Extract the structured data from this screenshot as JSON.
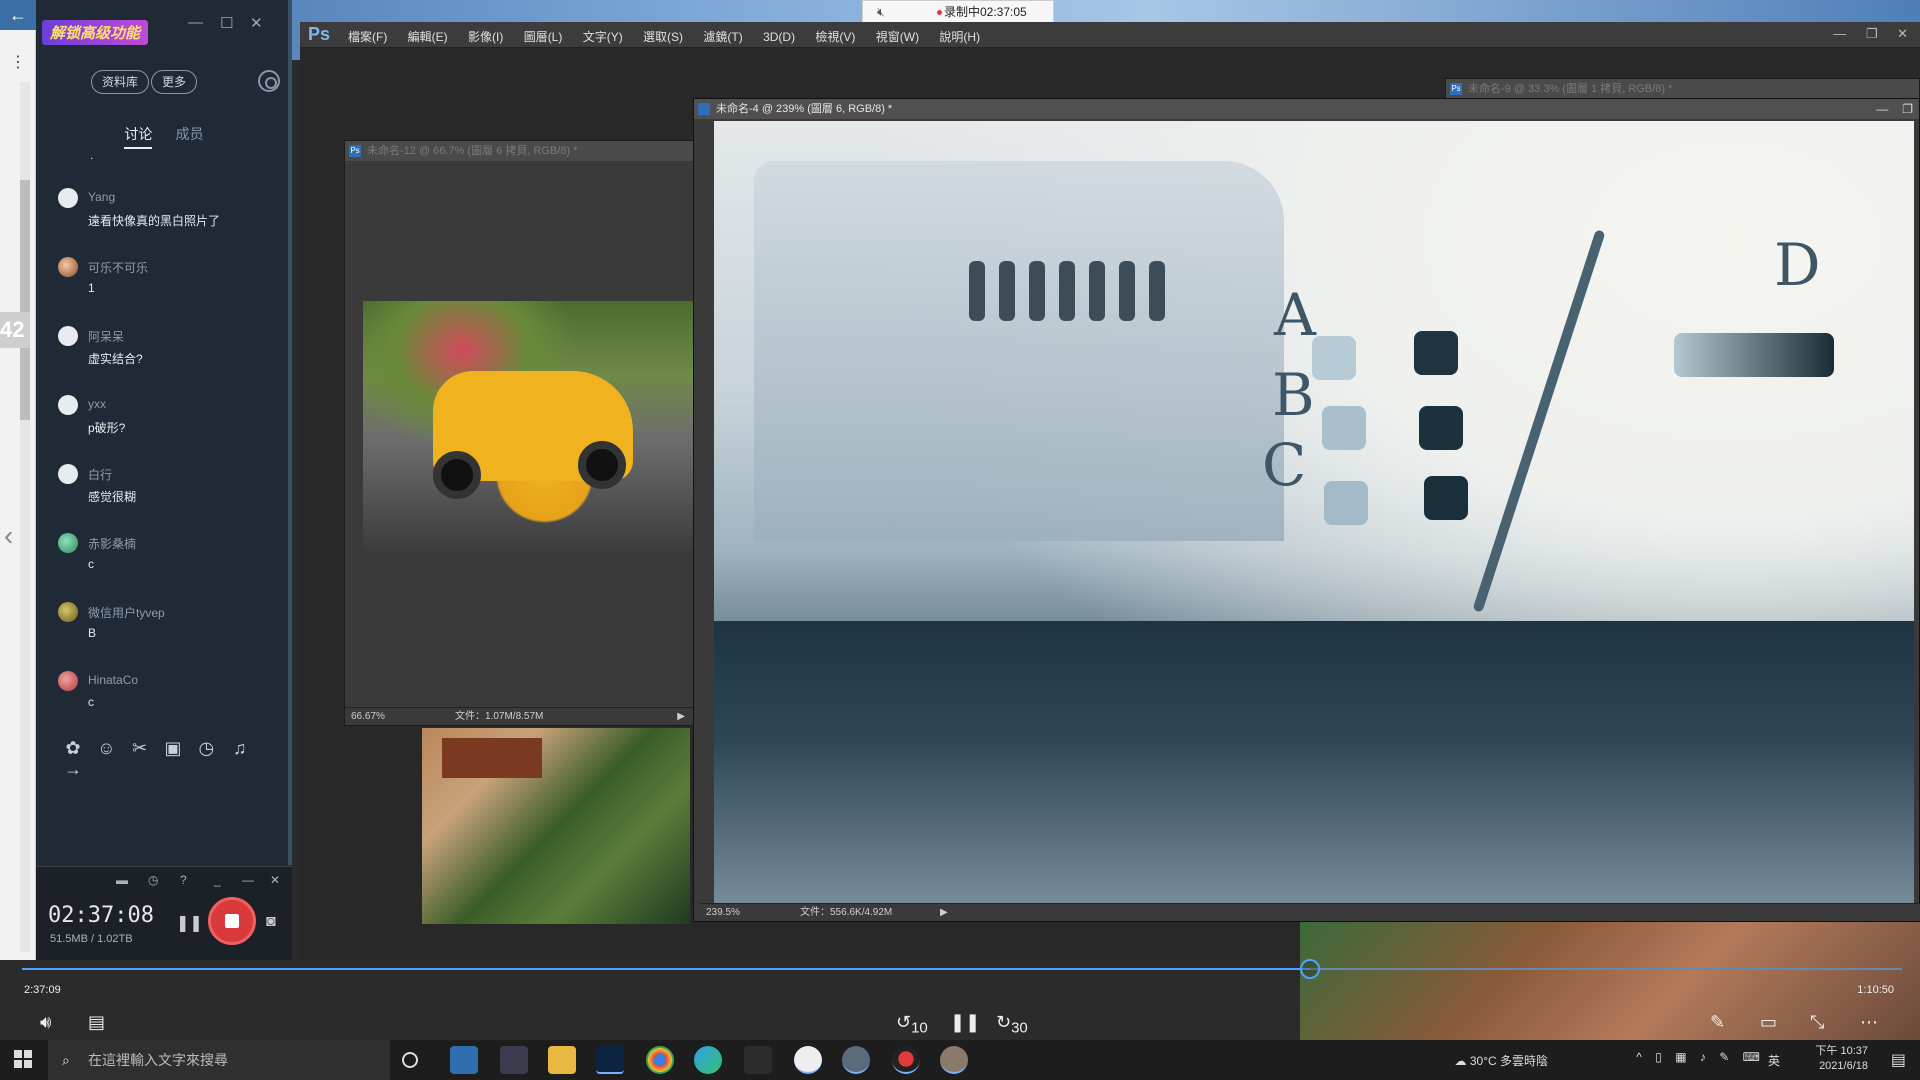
{
  "recording_indicator": {
    "label": "录制中02:37:05"
  },
  "chat": {
    "promo": "解锁高级功能",
    "buttons": {
      "library": "资料库",
      "more": "更多"
    },
    "tabs": {
      "discussion": "讨论",
      "members": "成员"
    },
    "dot": ".",
    "messages": [
      {
        "name": "Yang",
        "text": "遠看快像真的黑白照片了"
      },
      {
        "name": "可乐不可乐",
        "text": "1"
      },
      {
        "name": "阿呆呆",
        "text": "虚实结合?"
      },
      {
        "name": "yxx",
        "text": "p破形?"
      },
      {
        "name": "白行",
        "text": "感觉很糊"
      },
      {
        "name": "赤影桑楠",
        "text": "c"
      },
      {
        "name": "微信用户tyvep",
        "text": "B"
      },
      {
        "name": "HinataCo",
        "text": "c"
      }
    ]
  },
  "left_strip": {
    "badge": "42"
  },
  "recorder": {
    "time": "02:37:08",
    "size": "51.5MB / 1.02TB"
  },
  "photoshop": {
    "logo": "Ps",
    "menu": [
      "檔案(F)",
      "編輯(E)",
      "影像(I)",
      "圖層(L)",
      "文字(Y)",
      "選取(S)",
      "濾鏡(T)",
      "3D(D)",
      "檢視(V)",
      "視窗(W)",
      "說明(H)"
    ],
    "docs": {
      "doc12": {
        "title": "未命名-12 @ 66.7% (圖層 6 拷貝, RGB/8) *",
        "zoom": "66.67%",
        "file": "文件：1.07M/8.57M"
      },
      "doc9": {
        "title": "未命名-9 @ 33.3% (圖層 1 拷貝, RGB/8) *"
      },
      "doc4": {
        "title": "未命名-4 @ 239% (圖層 6, RGB/8) *",
        "zoom": "239.5%",
        "file": "文件：556.6K/4.92M"
      }
    },
    "painting_letters": [
      "A",
      "B",
      "C",
      "D"
    ]
  },
  "player": {
    "current": "2:37:09",
    "duration": "1:10:50",
    "skip_back": "10",
    "skip_forward": "30"
  },
  "taskbar": {
    "search_placeholder": "在這裡輸入文字來搜尋",
    "weather": "30°C 多雲時陰",
    "ime": "英",
    "time": "下午 10:37",
    "date": "2021/6/18"
  }
}
